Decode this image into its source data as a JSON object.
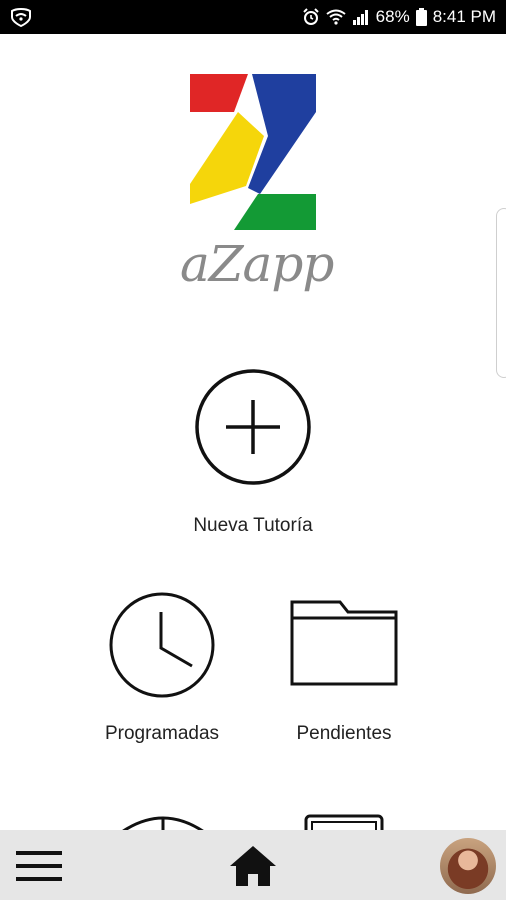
{
  "status_bar": {
    "battery_percent": "68%",
    "time": "8:41 PM",
    "icons": [
      "shield-icon",
      "alarm-icon",
      "wifi-icon",
      "signal-icon",
      "battery-icon"
    ]
  },
  "app": {
    "logo_text": "aZapp",
    "brand_colors": {
      "red": "#e02626",
      "blue": "#1f3f9f",
      "yellow": "#f5d60b",
      "green": "#139a35"
    }
  },
  "actions": {
    "new_tutoring": {
      "label": "Nueva Tutoría",
      "icon": "plus-circle-icon"
    },
    "scheduled": {
      "label": "Programadas",
      "icon": "clock-icon"
    },
    "pending": {
      "label": "Pendientes",
      "icon": "folder-icon"
    }
  },
  "bottom_nav": {
    "menu_icon": "hamburger-menu-icon",
    "home_icon": "home-icon",
    "profile_icon": "user-avatar"
  }
}
